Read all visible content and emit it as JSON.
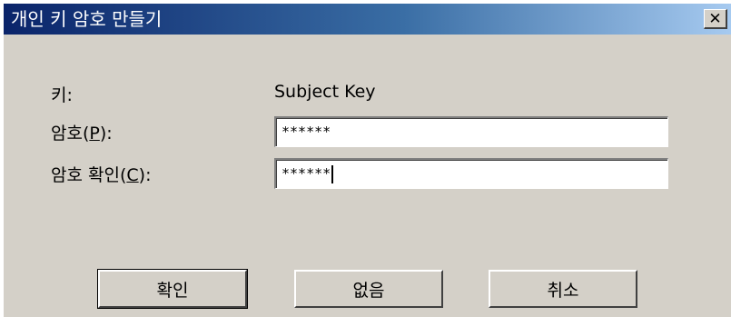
{
  "window": {
    "title": "개인 키 암호 만들기",
    "close_glyph": "✕"
  },
  "form": {
    "key_label": "키:",
    "key_value": "Subject Key",
    "password_label_prefix": "암호(",
    "password_label_mnemonic": "P",
    "password_label_suffix": "):",
    "password_value": "******",
    "confirm_label_prefix": "암호 확인(",
    "confirm_label_mnemonic": "C",
    "confirm_label_suffix": "):",
    "confirm_value": "******"
  },
  "buttons": {
    "ok": "확인",
    "none": "없음",
    "cancel": "취소"
  },
  "colors": {
    "titlebar_start": "#0a246a",
    "titlebar_end": "#a6caf0",
    "dialog_bg": "#d4d0c8"
  }
}
